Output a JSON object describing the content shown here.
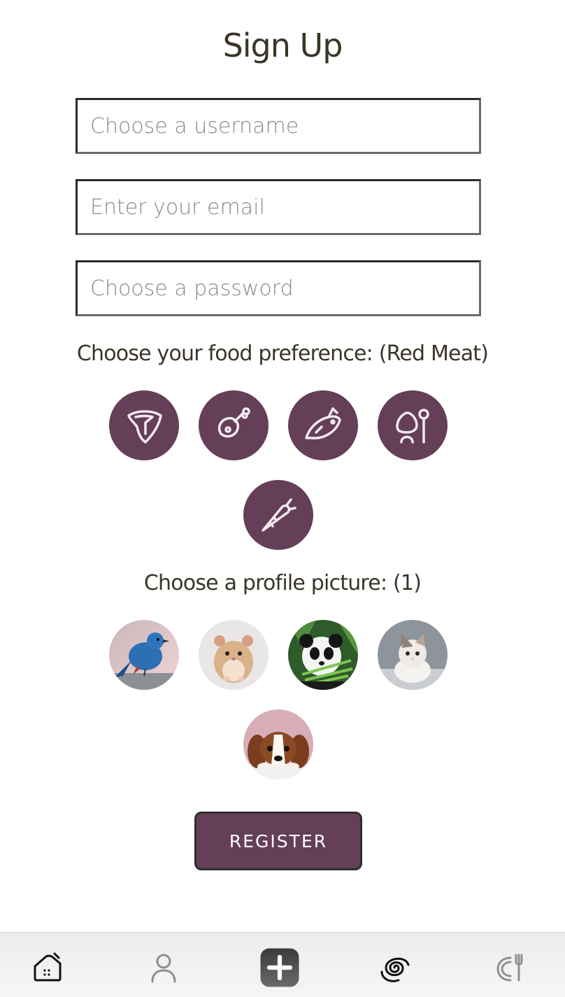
{
  "page": {
    "title": "Sign Up"
  },
  "form": {
    "username": {
      "value": "",
      "placeholder": "Choose a username"
    },
    "email": {
      "value": "",
      "placeholder": "Enter your email"
    },
    "password": {
      "value": "",
      "placeholder": "Choose a password"
    }
  },
  "food": {
    "label": "Choose your food preference: (Red Meat)",
    "options": [
      {
        "icon": "steak-icon"
      },
      {
        "icon": "chicken-leg-icon"
      },
      {
        "icon": "fish-icon"
      },
      {
        "icon": "egg-dairy-icon"
      },
      {
        "icon": "carrot-icon"
      }
    ]
  },
  "profile": {
    "label": "Choose a profile picture: (1)",
    "pictures": [
      {
        "subject": "blue-bird"
      },
      {
        "subject": "hamster"
      },
      {
        "subject": "panda"
      },
      {
        "subject": "kitten"
      },
      {
        "subject": "puppy"
      }
    ]
  },
  "register": {
    "label": "REGISTER"
  },
  "nav": {
    "items": [
      {
        "icon": "home-icon"
      },
      {
        "icon": "profile-icon"
      },
      {
        "icon": "add-icon"
      },
      {
        "icon": "spiral-icon"
      },
      {
        "icon": "cook-icon"
      }
    ]
  },
  "colors": {
    "accent": "#643f57",
    "text": "#3a3528",
    "nav_bg": "#efefef"
  }
}
